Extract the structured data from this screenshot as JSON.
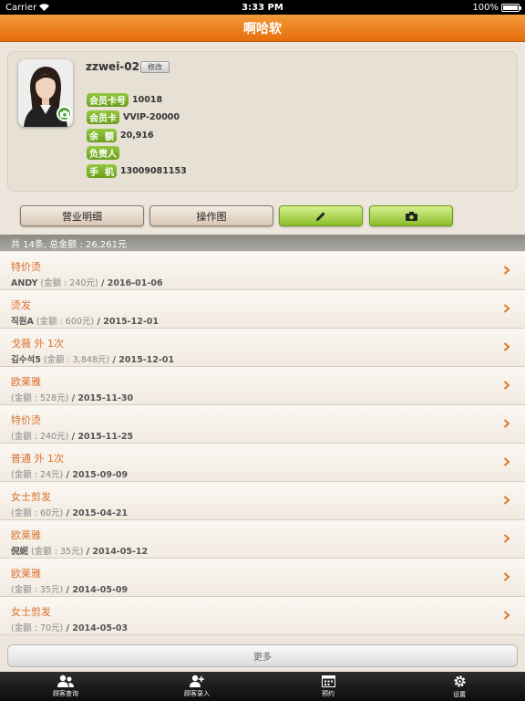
{
  "status_bar": {
    "carrier": "Carrier",
    "time": "3:33 PM",
    "battery": "100%"
  },
  "nav": {
    "title": "啊哈软"
  },
  "profile": {
    "username": "zzwei-02",
    "edit_label": "修改",
    "fields": [
      {
        "label": "会员卡号",
        "value": "10018"
      },
      {
        "label": "会员卡",
        "value": "VVIP-20000"
      },
      {
        "label": "余  额",
        "value": "20,916"
      },
      {
        "label": "负责人",
        "value": ""
      },
      {
        "label": "手  机",
        "value": "13009081153"
      }
    ]
  },
  "actions": {
    "business_detail": "营业明细",
    "operation_chart": "操作图"
  },
  "summary": "共 14条, 总金额 : 26,261元",
  "records": [
    {
      "title": "特价烫",
      "person": "ANDY",
      "amount": " (金额 : 240元)",
      "date": " / 2016-01-06"
    },
    {
      "title": "烫发",
      "person": "직원A",
      "amount": " (金额 : 600元)",
      "date": " / 2015-12-01"
    },
    {
      "title": "戈薇 外 1次",
      "person": "김수석5",
      "amount": " (金额 : 3,848元)",
      "date": " / 2015-12-01"
    },
    {
      "title": "欧莱雅",
      "person": "",
      "amount": " (金额 : 528元)",
      "date": " / 2015-11-30"
    },
    {
      "title": "特价烫",
      "person": "",
      "amount": " (金额 : 240元)",
      "date": " / 2015-11-25"
    },
    {
      "title": "普通 外 1次",
      "person": "",
      "amount": " (金额 : 24元)",
      "date": " / 2015-09-09"
    },
    {
      "title": "女士剪发",
      "person": "",
      "amount": " (金额 : 60元)",
      "date": " / 2015-04-21"
    },
    {
      "title": "欧莱雅",
      "person": "倪妮",
      "amount": " (金额 : 35元)",
      "date": " / 2014-05-12"
    },
    {
      "title": "欧莱雅",
      "person": "",
      "amount": " (金额 : 35元)",
      "date": " / 2014-05-09"
    },
    {
      "title": "女士剪发",
      "person": "",
      "amount": " (金额 : 70元)",
      "date": " / 2014-05-03"
    }
  ],
  "more_label": "更多",
  "tabs": [
    {
      "label": "顾客查询",
      "icon": "customers-icon"
    },
    {
      "label": "顾客录入",
      "icon": "add-customer-icon"
    },
    {
      "label": "预约",
      "icon": "calendar-icon"
    },
    {
      "label": "设置",
      "icon": "gear-icon"
    }
  ],
  "colors": {
    "accent_orange": "#e66d0c",
    "record_title": "#d9702a",
    "pill_green": "#7ab02a"
  }
}
